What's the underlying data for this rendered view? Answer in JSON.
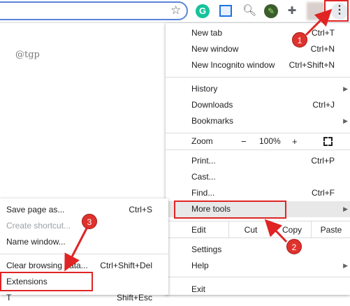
{
  "page": {
    "watermark": "@tgp"
  },
  "toolbar": {
    "extensions": [
      "grammarly-icon",
      "reader-icon",
      "magnifier-icon",
      "leaf-icon",
      "puzzle-icon"
    ],
    "grammarly_letter": "G"
  },
  "menu": {
    "new_tab": {
      "label": "New tab",
      "shortcut": "Ctrl+T"
    },
    "new_window": {
      "label": "New window",
      "shortcut": "Ctrl+N"
    },
    "incognito": {
      "label": "New Incognito window",
      "shortcut": "Ctrl+Shift+N"
    },
    "history": {
      "label": "History"
    },
    "downloads": {
      "label": "Downloads",
      "shortcut": "Ctrl+J"
    },
    "bookmarks": {
      "label": "Bookmarks"
    },
    "zoom": {
      "label": "Zoom",
      "minus": "−",
      "value": "100%",
      "plus": "+"
    },
    "print": {
      "label": "Print...",
      "shortcut": "Ctrl+P"
    },
    "cast": {
      "label": "Cast..."
    },
    "find": {
      "label": "Find...",
      "shortcut": "Ctrl+F"
    },
    "more_tools": {
      "label": "More tools"
    },
    "edit": {
      "label": "Edit",
      "cut": "Cut",
      "copy": "Copy",
      "paste": "Paste"
    },
    "settings": {
      "label": "Settings"
    },
    "help": {
      "label": "Help"
    },
    "exit": {
      "label": "Exit"
    }
  },
  "submenu": {
    "save_page": {
      "label": "Save page as...",
      "shortcut": "Ctrl+S"
    },
    "create_shortcut": {
      "label": "Create shortcut..."
    },
    "name_window": {
      "label": "Name window..."
    },
    "clear_browsing": {
      "label": "Clear browsing data...",
      "shortcut": "Ctrl+Shift+Del"
    },
    "extensions": {
      "label": "Extensions"
    },
    "cut_off": {
      "label": "T",
      "shortcut": "Shift+Esc"
    }
  },
  "annotations": {
    "badge1": "1",
    "badge2": "2",
    "badge3": "3",
    "color": "#e02424"
  }
}
